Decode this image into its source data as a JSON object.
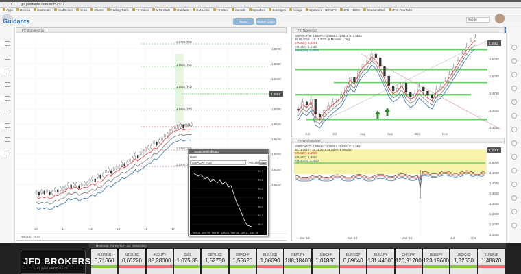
{
  "browser": {
    "nav": "← → C",
    "address": "go.guidants.com/#c/57937",
    "bookmarks": [
      "Apps",
      "Devisia",
      "Godmode",
      "GoldSeiten",
      "News",
      "Charts",
      "Trading-Tools",
      "FX-Maker",
      "MT4-Stats",
      "Guidants",
      "GM-Links",
      "FX-Sites",
      "Sounds",
      "Sprachen",
      "Sonstiges",
      "Ablage",
      "Spotware - NDD FX",
      "JFD - DESK",
      "SeasonalBull",
      "JFD - YouTube"
    ]
  },
  "app": {
    "logo": "Guidants",
    "btn_markt": "Markt",
    "btn_broker": "Broker Login",
    "search": "Suche",
    "news_badge": "16 neue Beiträge"
  },
  "p1": {
    "title": "FX-Stundenchart",
    "line1": "GBP/CHF  O: 1,5539  H: 1,5569  L: 1,5539  C: 1,5562",
    "line2": "06.11.2015 (09:00 - 08:00 (1 Woche, 1 Stunde)",
    "legend": "EMA(20): 1,5514   EMA(50): 1,5468   EMA(100): 1,5487   Vortageskurse   PP(D): 1,5493",
    "ticks": [
      "1,5700",
      "1,5650",
      "1,5600",
      "1,5550",
      "1,5500",
      "1,5450",
      "1,5400",
      "1,5350",
      "1,5300",
      "1,5250"
    ],
    "price_tag": "1,5562",
    "levels": [
      "1,5725 (R3)",
      "1,5630 (R2)",
      "1,5582 (R1)",
      "1,5493 (PP)",
      "1,5439 (S1)",
      "1,5350 (S2)",
      "1,5200 (S3)"
    ],
    "dates": [
      "10",
      "11",
      "12",
      "13",
      "16",
      "17",
      "18",
      "19"
    ],
    "rsi": "RSI(14): 79,53"
  },
  "p2": {
    "title": "FX-Tageschart",
    "line1": "GBP/CHF  O: 1,5527  H: 1,5569  L: 1,5512  C: 1,5562",
    "line2": "19.05.2015 - 18.11.2015 (6 Monate, 1 Tag)",
    "legend": [
      "EMA(20): 1,5264",
      "EMA(50): 1,5110",
      "EMA(100): 1,4865"
    ],
    "ticks": [
      "1,5500",
      "1,5250",
      "1,5000",
      "1,4750",
      "1,4500",
      "1,4250"
    ],
    "price_tag": "1,5562",
    "dates": [
      "Jun",
      "Jul",
      "Aug",
      "Sep",
      "Okt",
      "Nov"
    ]
  },
  "p3": {
    "title": "FX-Wochenchart",
    "line1": "GBP/CHF  O: 1,5304  H: 1,5569  L: 1,5264  C: 1,5561",
    "line2": "18.11.2012 - 18.11.2015 (3 Jahre, 1 Woche)",
    "legend": [
      "EMA(20): 1,4980",
      "EMA(50): 1,4852",
      "EMA(100): 1,4823"
    ],
    "ticks": [
      "1,5500",
      "1,5000",
      "1,4500",
      "1,4000",
      "1,3500",
      "1,3000",
      "1,2500",
      "1,2000",
      "1,1500"
    ],
    "price_tag": "1,5561",
    "dates": [
      "Jan '13",
      "Jan '14",
      "Jan '15",
      "Jul",
      "Okt"
    ]
  },
  "popup": {
    "title": "Sentimentindikator",
    "markt": "Markt",
    "select": "GBP/CHF 7-22",
    "vl_label": "Vorschautage",
    "vl_value": "20",
    "ticks": [
      "99,7",
      "99,5",
      "99,3",
      "99,1",
      "98,9",
      "98,7",
      "98,5"
    ],
    "dates": [
      "Nov 20",
      "Nov 25",
      "Nov 30",
      "Dec 03",
      "Dec 08",
      "Dec 11",
      "Dec 15"
    ]
  },
  "heatmap": {
    "title": "Heatmap „Forex-TOP-15\" (Watchlist)",
    "brand": "JFD BROKERS",
    "slogan": "JUST FAIR AND DIRECT",
    "tiles": [
      {
        "name": "AUD/USD",
        "value": "0,71660",
        "color": "#8bc34a"
      },
      {
        "name": "NZD/USD",
        "value": "0,65220",
        "color": "#e57373"
      },
      {
        "name": "AUD/JPY",
        "value": "88,28000",
        "color": "#e57373"
      },
      {
        "name": "Gold",
        "value": "1.075,35",
        "color": "#8bc34a"
      },
      {
        "name": "GBP/USD",
        "value": "1,52750",
        "color": "#8bc34a"
      },
      {
        "name": "GBP/CHF",
        "value": "1,55620",
        "color": "#8bc34a"
      },
      {
        "name": "EUR/USD",
        "value": "1,06690",
        "color": "#e57373"
      },
      {
        "name": "GBP/JPY",
        "value": "188,18400",
        "color": "#8bc34a"
      },
      {
        "name": "USD/CHF",
        "value": "1,01880",
        "color": "#8bc34a"
      },
      {
        "name": "EUR/GBP",
        "value": "0,69840",
        "color": "#e57373"
      },
      {
        "name": "EUR/JPY",
        "value": "131,44000",
        "color": "#e57373"
      },
      {
        "name": "CHF/JPY",
        "value": "120,91700",
        "color": "#e57373"
      },
      {
        "name": "USD/JPY",
        "value": "123,19600",
        "color": "#8bc34a"
      },
      {
        "name": "USD/CAD",
        "value": "1,32630",
        "color": "#8bc34a"
      },
      {
        "name": "EUR/AUD",
        "value": "1,48870",
        "color": "#e57373"
      }
    ]
  }
}
